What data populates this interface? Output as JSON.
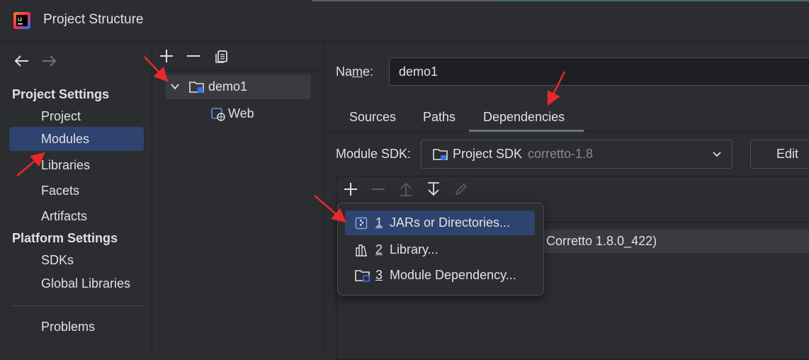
{
  "window": {
    "title": "Project Structure",
    "app_icon": "intellij-idea-logo-icon"
  },
  "navigation": {
    "back_icon": "back-arrow-icon",
    "forward_icon": "forward-arrow-icon"
  },
  "sidebar": {
    "project_settings_heading": "Project Settings",
    "project_items": [
      {
        "label": "Project",
        "selected": false
      },
      {
        "label": "Modules",
        "selected": true
      },
      {
        "label": "Libraries",
        "selected": false
      },
      {
        "label": "Facets",
        "selected": false
      },
      {
        "label": "Artifacts",
        "selected": false
      }
    ],
    "platform_settings_heading": "Platform Settings",
    "platform_items": [
      {
        "label": "SDKs"
      },
      {
        "label": "Global Libraries"
      }
    ],
    "problems_label": "Problems"
  },
  "modules_pane": {
    "toolbar": [
      "add-icon",
      "remove-icon",
      "copy-icon"
    ],
    "tree": {
      "module": {
        "label": "demo1",
        "expanded": true
      },
      "facets": [
        {
          "label": "Web"
        }
      ]
    }
  },
  "module_editor": {
    "name_label": "Name:",
    "name_mnemonic": "m",
    "name_value": "demo1",
    "tabs": [
      {
        "label": "Sources",
        "active": false
      },
      {
        "label": "Paths",
        "active": false
      },
      {
        "label": "Dependencies",
        "active": true
      }
    ],
    "module_sdk_label": "Module SDK:",
    "module_sdk_value": "Project SDK",
    "module_sdk_detail": "corretto-1.8",
    "edit_button": "Edit",
    "dependencies_toolbar": [
      "add-icon",
      "remove-icon",
      "move-up-icon",
      "move-down-icon",
      "edit-pencil-icon"
    ],
    "dependency_row_text": "Corretto 1.8.0_422)"
  },
  "add_dependency_popup": {
    "items": [
      {
        "number": "1",
        "label": "JARs or Directories...",
        "icon": "jar-directory-icon",
        "selected": true
      },
      {
        "number": "2",
        "label": "Library...",
        "icon": "library-icon",
        "selected": false
      },
      {
        "number": "3",
        "label": "Module Dependency...",
        "icon": "module-icon",
        "selected": false
      }
    ]
  },
  "annotations": {
    "arrow_color": "#e8282b"
  }
}
